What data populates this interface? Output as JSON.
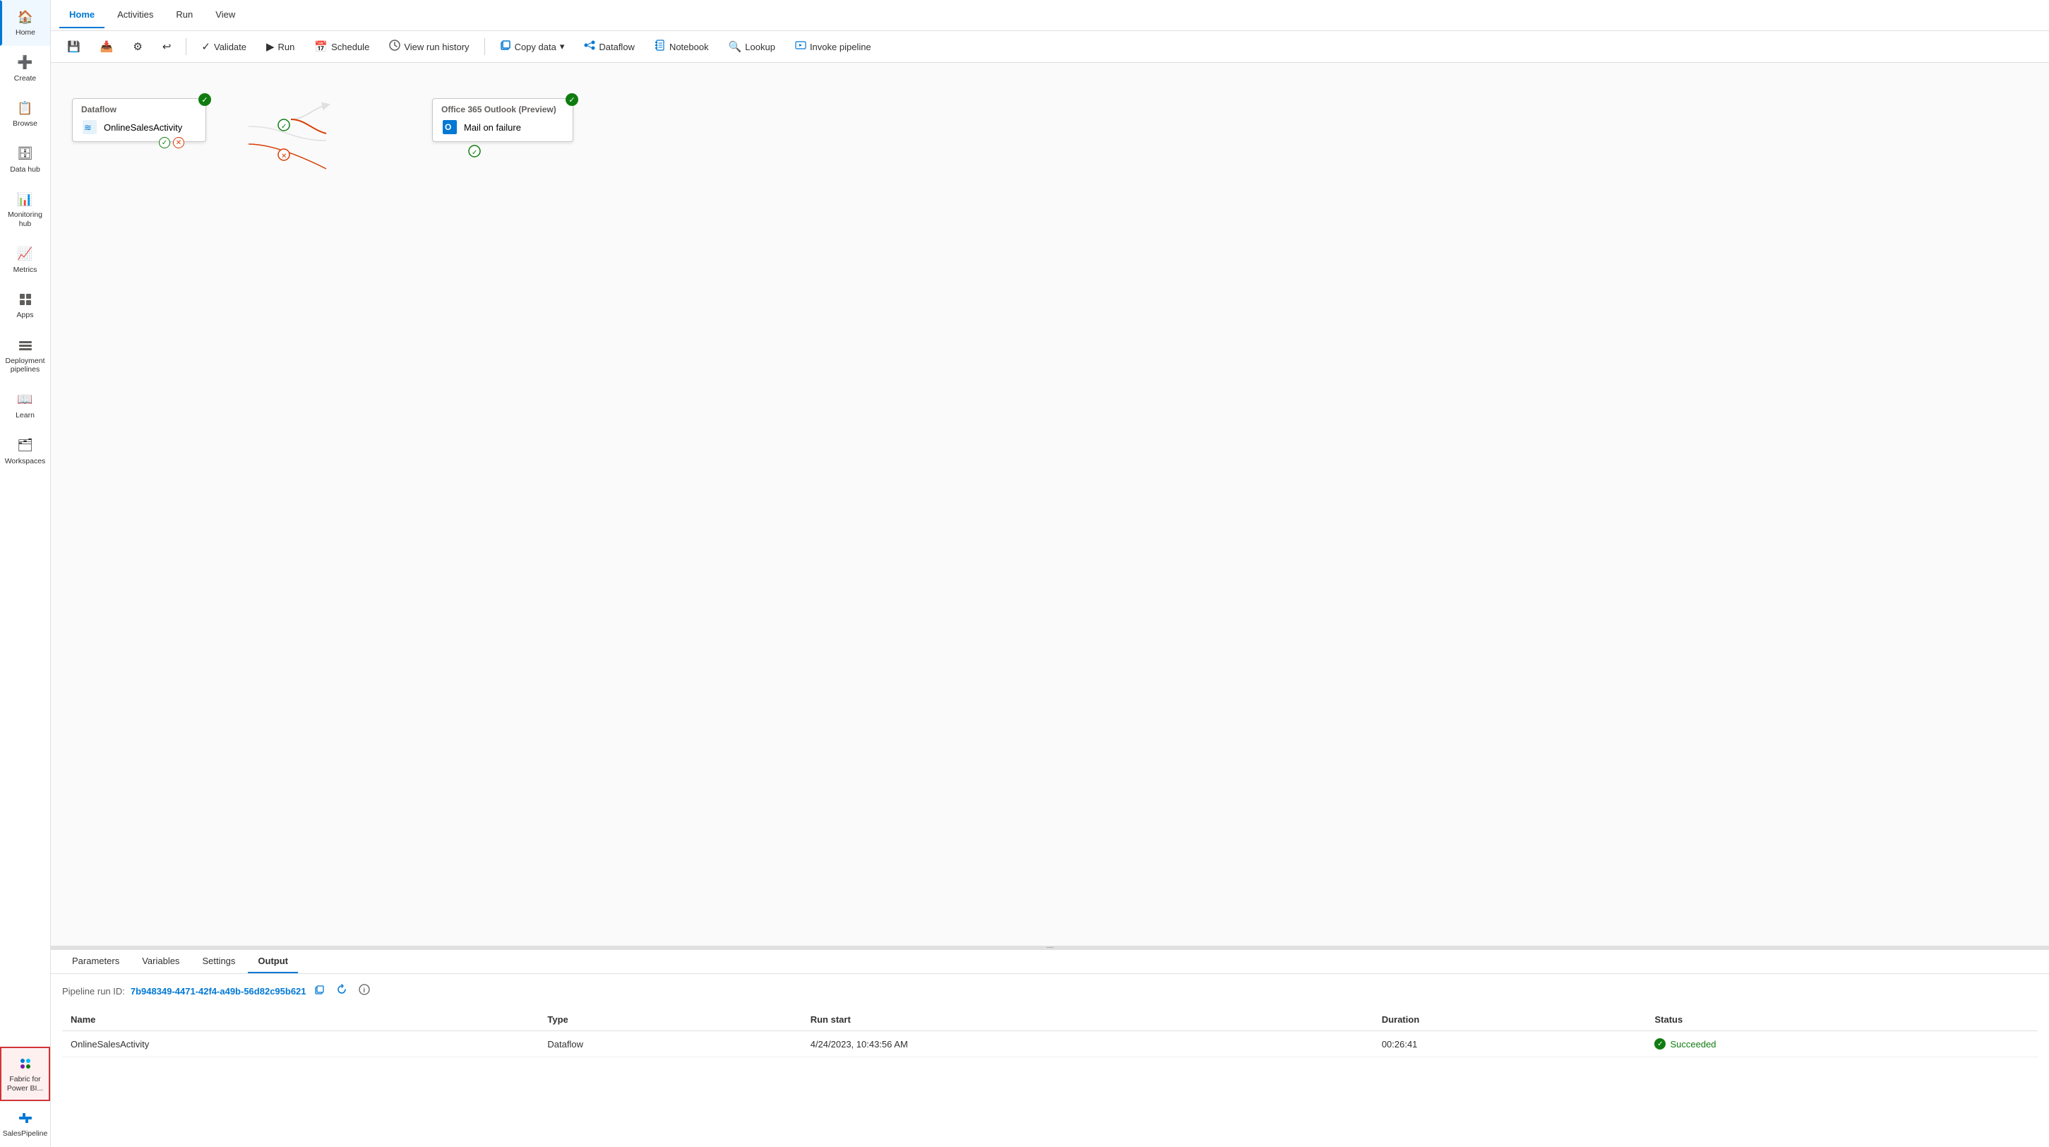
{
  "sidebar": {
    "items": [
      {
        "id": "home",
        "label": "Home",
        "icon": "🏠",
        "active": true
      },
      {
        "id": "create",
        "label": "Create",
        "icon": "➕"
      },
      {
        "id": "browse",
        "label": "Browse",
        "icon": "📋"
      },
      {
        "id": "datahub",
        "label": "Data hub",
        "icon": "🗄"
      },
      {
        "id": "monitoring",
        "label": "Monitoring hub",
        "icon": "📊"
      },
      {
        "id": "metrics",
        "label": "Metrics",
        "icon": "📈"
      },
      {
        "id": "apps",
        "label": "Apps",
        "icon": "⊞"
      },
      {
        "id": "deployment",
        "label": "Deployment pipelines",
        "icon": "🚀"
      },
      {
        "id": "learn",
        "label": "Learn",
        "icon": "📖"
      },
      {
        "id": "workspaces",
        "label": "Workspaces",
        "icon": "🗂"
      }
    ],
    "bottom_items": [
      {
        "id": "fabric",
        "label": "Fabric for Power BI...",
        "icon": "⚙",
        "highlighted": true
      },
      {
        "id": "salespipeline",
        "label": "SalesPipeline",
        "icon": "⧖"
      }
    ]
  },
  "top_tabs": [
    {
      "id": "home",
      "label": "Home",
      "active": true
    },
    {
      "id": "activities",
      "label": "Activities"
    },
    {
      "id": "run",
      "label": "Run"
    },
    {
      "id": "view",
      "label": "View"
    }
  ],
  "toolbar": {
    "save_label": "Save",
    "save_icon": "💾",
    "savedraft_icon": "📥",
    "settings_icon": "⚙",
    "undo_icon": "↩",
    "validate_label": "Validate",
    "validate_icon": "✓",
    "run_label": "Run",
    "run_icon": "▶",
    "schedule_label": "Schedule",
    "schedule_icon": "📅",
    "viewrunhistory_label": "View run history",
    "viewrunhistory_icon": "⚡",
    "copydata_label": "Copy data",
    "copydata_icon": "📋",
    "dataflow_label": "Dataflow",
    "dataflow_icon": "🔀",
    "notebook_label": "Notebook",
    "notebook_icon": "📓",
    "lookup_label": "Lookup",
    "lookup_icon": "🔍",
    "invokepipeline_label": "Invoke pipeline",
    "invokepipeline_icon": "📢"
  },
  "canvas": {
    "dataflow_node": {
      "header": "Dataflow",
      "activity_name": "OnlineSalesActivity",
      "has_success": true
    },
    "office365_node": {
      "header": "Office 365 Outlook (Preview)",
      "activity_name": "Mail on failure",
      "has_success": true
    }
  },
  "bottom_panel": {
    "tabs": [
      {
        "id": "parameters",
        "label": "Parameters"
      },
      {
        "id": "variables",
        "label": "Variables"
      },
      {
        "id": "settings",
        "label": "Settings"
      },
      {
        "id": "output",
        "label": "Output",
        "active": true
      }
    ],
    "pipeline_run_id_label": "Pipeline run ID:",
    "pipeline_run_id_value": "7b948349-4471-42f4-a49b-56d82c95b621",
    "table": {
      "columns": [
        {
          "id": "name",
          "label": "Name"
        },
        {
          "id": "type",
          "label": "Type"
        },
        {
          "id": "run_start",
          "label": "Run start"
        },
        {
          "id": "duration",
          "label": "Duration"
        },
        {
          "id": "status",
          "label": "Status"
        }
      ],
      "rows": [
        {
          "name": "OnlineSalesActivity",
          "type": "Dataflow",
          "run_start": "4/24/2023, 10:43:56 AM",
          "duration": "00:26:41",
          "status": "Succeeded"
        }
      ]
    }
  }
}
